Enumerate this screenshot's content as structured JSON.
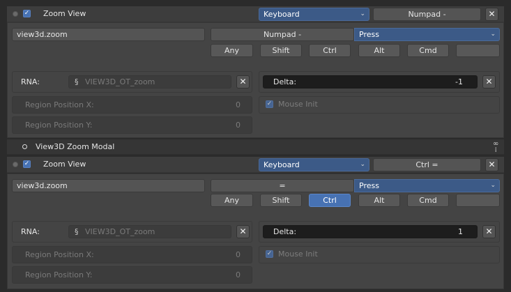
{
  "item1": {
    "title": "Zoom View",
    "checked": true,
    "map_type": "Keyboard",
    "key_display": "Numpad -",
    "idname": "view3d.zoom",
    "key_field": "Numpad -",
    "event_value": "Press",
    "modifiers": {
      "any": "Any",
      "shift": "Shift",
      "ctrl": "Ctrl",
      "alt": "Alt",
      "cmd": "Cmd"
    },
    "active_modifier": "",
    "rna_label": "RNA:",
    "rna_value": "VIEW3D_OT_zoom",
    "delta_label": "Delta:",
    "delta_value": "-1",
    "region_x_label": "Region Position X:",
    "region_x_value": "0",
    "region_y_label": "Region Position Y:",
    "region_y_value": "0",
    "mouse_init_label": "Mouse Init",
    "mouse_init_checked": true
  },
  "section_header": {
    "title": "View3D Zoom Modal"
  },
  "item2": {
    "title": "Zoom View",
    "checked": true,
    "map_type": "Keyboard",
    "key_display": "Ctrl =",
    "idname": "view3d.zoom",
    "key_field": "=",
    "event_value": "Press",
    "modifiers": {
      "any": "Any",
      "shift": "Shift",
      "ctrl": "Ctrl",
      "alt": "Alt",
      "cmd": "Cmd"
    },
    "active_modifier": "Ctrl",
    "rna_label": "RNA:",
    "rna_value": "VIEW3D_OT_zoom",
    "delta_label": "Delta:",
    "delta_value": "1",
    "region_x_label": "Region Position X:",
    "region_x_value": "0",
    "region_y_label": "Region Position Y:",
    "region_y_value": "0",
    "mouse_init_label": "Mouse Init",
    "mouse_init_checked": true
  },
  "icons": {
    "close": "close-icon",
    "chevron": "chevron-down-icon",
    "check": "checkmark-icon",
    "rna": "rna-icon",
    "drag": "drag-handle-icon"
  },
  "colors": {
    "accent": "#4772b3",
    "dropdown_blue": "#3c5a87",
    "panel": "#444444",
    "background": "#2b2b2b"
  }
}
